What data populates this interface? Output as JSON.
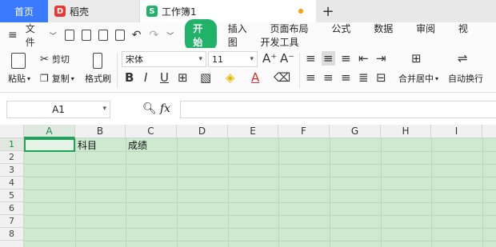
{
  "tabs": {
    "home": "首页",
    "daoke": "稻壳",
    "workbook": "工作簿1",
    "new_tab": "+"
  },
  "menubar": {
    "file": "文件",
    "start": "开始",
    "items": [
      "插入",
      "页面布局",
      "公式",
      "数据",
      "审阅",
      "视图",
      "开发工具"
    ]
  },
  "ribbon": {
    "paste": "粘贴",
    "cut": "剪切",
    "copy": "复制",
    "format_painter": "格式刷",
    "font_name": "宋体",
    "font_size": "11",
    "merge_center": "合并居中",
    "wrap_text": "自动换行"
  },
  "formula_bar": {
    "name_box": "A1",
    "fx": "fx",
    "formula": ""
  },
  "sheet": {
    "columns": [
      "A",
      "B",
      "C",
      "D",
      "E",
      "F",
      "G",
      "H",
      "I"
    ],
    "rows": [
      "1",
      "2",
      "3",
      "4",
      "5",
      "6",
      "7",
      "8"
    ],
    "cells": {
      "B1": "科目",
      "C1": "成绩"
    }
  },
  "colors": {
    "accent": "#21b26a",
    "home_tab": "#3a7afe",
    "sheet_bg": "#cde9cf"
  }
}
